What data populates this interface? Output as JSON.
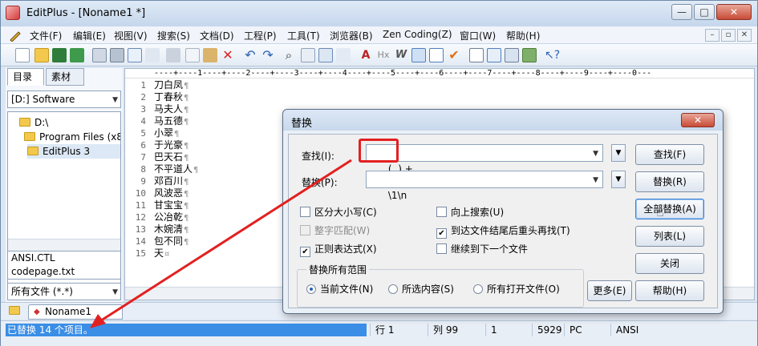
{
  "window": {
    "title": "EditPlus - [Noname1 *]",
    "controls": {
      "minimize": "—",
      "maximize": "□",
      "close": "✕"
    }
  },
  "menu": {
    "items": [
      "文件(F)",
      "编辑(E)",
      "视图(V)",
      "搜索(S)",
      "文档(D)",
      "工程(P)",
      "工具(T)",
      "浏览器(B)",
      "Zen Coding(Z)",
      "窗口(W)",
      "帮助(H)"
    ],
    "mdi_controls": [
      "–",
      "▫",
      "✕"
    ]
  },
  "toolbar": {
    "icons": [
      "new-file-icon",
      "open-file-icon",
      "save-icon",
      "save-all-icon",
      "print-preview-icon",
      "print-icon",
      "spell-check-icon",
      "find-icon",
      "cut-icon",
      "copy-icon",
      "paste-icon",
      "delete-icon",
      "undo-icon",
      "redo-icon",
      "search-icon",
      "replace-icon",
      "find-in-files-icon",
      "goto-line-icon",
      "font-icon",
      "hex-icon",
      "word-wrap-icon",
      "ruler-icon",
      "line-number-icon",
      "spell-mark-icon",
      "view-icon",
      "browser-icon",
      "screen-icon",
      "fullscreen-icon",
      "help-cursor-icon"
    ]
  },
  "left_panel": {
    "tabs": [
      "目录",
      "素材"
    ],
    "drive": "[D:] Software",
    "tree": [
      "D:\\",
      "Program Files (x8",
      "EditPlus 3"
    ],
    "files": [
      "ANSI.CTL",
      "codepage.txt"
    ],
    "filter": "所有文件 (*.*)"
  },
  "editor": {
    "ruler": "----+----1----+----2----+----3----+----4----+----5----+----6----+----7----+----8----+----9----+----0---",
    "lines": [
      "刀白凤",
      "丁春秋",
      "马夫人",
      "马五德",
      "小翠",
      "于光豪",
      "巴天石",
      "不平道人",
      "邓百川",
      "风波恶",
      "甘宝宝",
      "公冶乾",
      "木婉清",
      "包不同",
      "天"
    ],
    "line_numbers": [
      "1",
      "2",
      "3",
      "4",
      "5",
      "6",
      "7",
      "8",
      "9",
      "10",
      "11",
      "12",
      "13",
      "14",
      "15"
    ],
    "eol_mark": "¶",
    "eof_mark": "¤"
  },
  "doc_tabs": {
    "active": "Noname1"
  },
  "status": {
    "message": "已替换 14 个项目。",
    "line": "行 1",
    "column": "列 99",
    "sel": "1",
    "size": "5929",
    "eol": "PC",
    "encoding": "ANSI"
  },
  "dialog": {
    "title": "替换",
    "close": "✕",
    "find_label": "查找(I):",
    "find_value": "(..) +",
    "replace_label": "替换(P):",
    "replace_value": "\\1\\n",
    "options": {
      "match_case": "区分大小写(C)",
      "whole_word": "整字匹配(W)",
      "regex": "正则表达式(X)",
      "search_up": "向上搜索(U)",
      "wrap_around": "到达文件结尾后重头再找(T)",
      "next_file": "继续到下一个文件"
    },
    "scope_title": "替换所有范围",
    "scope": [
      "当前文件(N)",
      "所选内容(S)",
      "所有打开文件(O)"
    ],
    "buttons": {
      "find": "查找(F)",
      "replace": "替换(R)",
      "replace_all": "全部替换(A)",
      "list": "列表(L)",
      "close": "关闭",
      "more": "更多(E)",
      "help": "帮助(H)"
    }
  },
  "colors": {
    "annotation": "#e32020",
    "status_highlight": "#3a8ee6"
  }
}
